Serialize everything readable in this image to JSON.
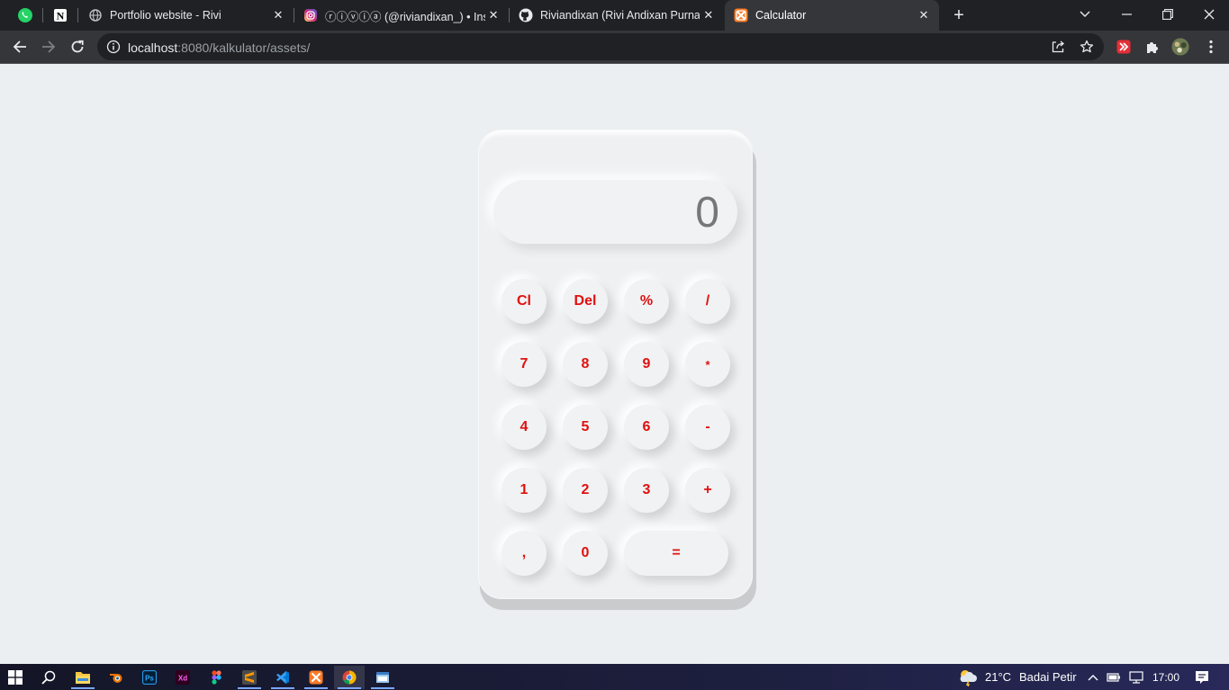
{
  "browser": {
    "pinned_tabs": [
      {
        "icon": "whatsapp-icon"
      },
      {
        "icon": "notion-icon"
      }
    ],
    "tabs": [
      {
        "title": "Portfolio website - Rivi",
        "icon": "globe-icon"
      },
      {
        "title": "ⓡⓘⓥⓘⓐ (@riviandixan_) • Instagram",
        "icon": "instagram-icon"
      },
      {
        "title": "Riviandixan (Rivi Andixan Purnadi)",
        "icon": "github-icon"
      },
      {
        "title": "Calculator",
        "icon": "xampp-icon",
        "active": true
      }
    ],
    "url": {
      "host": "localhost",
      "rest": ":8080/kalkulator/assets/"
    }
  },
  "calculator": {
    "display": "0",
    "keys": [
      {
        "label": "Cl",
        "name": "clear"
      },
      {
        "label": "Del",
        "name": "delete"
      },
      {
        "label": "%",
        "name": "percent"
      },
      {
        "label": "/",
        "name": "divide"
      },
      {
        "label": "7",
        "name": "seven"
      },
      {
        "label": "8",
        "name": "eight"
      },
      {
        "label": "9",
        "name": "nine"
      },
      {
        "label": "*",
        "name": "multiply"
      },
      {
        "label": "4",
        "name": "four"
      },
      {
        "label": "5",
        "name": "five"
      },
      {
        "label": "6",
        "name": "six"
      },
      {
        "label": "-",
        "name": "subtract"
      },
      {
        "label": "1",
        "name": "one"
      },
      {
        "label": "2",
        "name": "two"
      },
      {
        "label": "3",
        "name": "three"
      },
      {
        "label": "+",
        "name": "add"
      },
      {
        "label": ",",
        "name": "comma"
      },
      {
        "label": "0",
        "name": "zero"
      },
      {
        "label": "=",
        "name": "equals"
      }
    ],
    "key_color": "#e01010"
  },
  "taskbar": {
    "apps": [
      "start-icon",
      "search-icon",
      "file-explorer-icon",
      "blender-icon",
      "photoshop-icon",
      "adobe-xd-icon",
      "figma-icon",
      "sublime-text-icon",
      "vscode-icon",
      "xampp-icon",
      "chrome-icon",
      "window-app-icon"
    ],
    "weather": {
      "temp": "21°C",
      "condition": "Badai Petir"
    },
    "time": "17:00"
  }
}
